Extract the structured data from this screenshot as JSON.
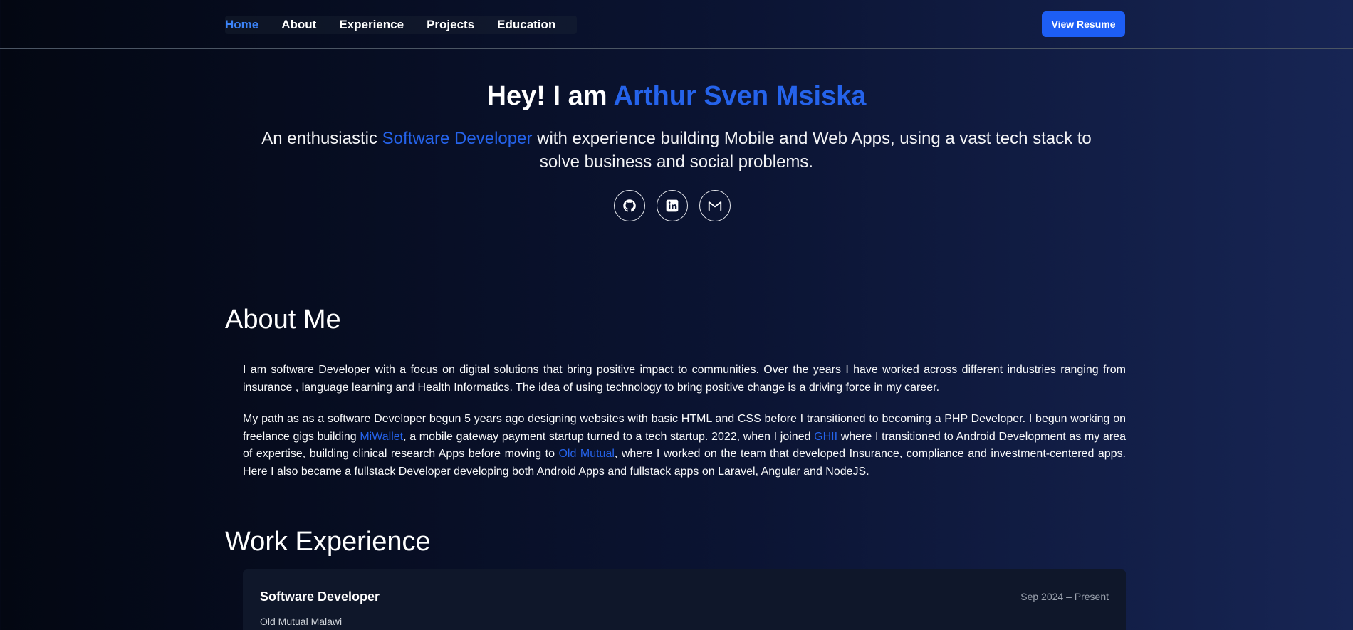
{
  "nav": {
    "items": [
      {
        "label": "Home",
        "active": true
      },
      {
        "label": "About"
      },
      {
        "label": "Experience"
      },
      {
        "label": "Projects"
      },
      {
        "label": "Education"
      }
    ],
    "resume_label": "View Resume"
  },
  "hero": {
    "greeting": "Hey! I am ",
    "name": "Arthur Sven Msiska",
    "subtitle_prefix": "An enthusiastic ",
    "subtitle_role": "Software Developer",
    "subtitle_suffix": " with experience building Mobile and Web Apps, using a vast tech stack to solve business and social problems.",
    "socials": [
      {
        "icon": "github-icon"
      },
      {
        "icon": "linkedin-icon"
      },
      {
        "icon": "gmail-icon"
      }
    ]
  },
  "about": {
    "title": "About Me",
    "p1": "I am software Developer with a focus on digital solutions that bring positive impact to communities. Over the years I have worked across different industries ranging from insurance , language learning and Health Informatics. The idea of using technology to bring positive change is a driving force in my career.",
    "p2_a": "My path as as a software Developer begun 5 years ago designing websites with basic HTML and CSS before I transitioned to becoming a PHP Developer. I begun working on freelance gigs building ",
    "p2_link1": "MiWallet",
    "p2_b": ", a mobile gateway payment startup turned to a tech startup. 2022, when I joined ",
    "p2_link2": "GHII",
    "p2_c": " where I transitioned to Android Development as my area of expertise, building clinical research Apps before moving to ",
    "p2_link3": "Old Mutual",
    "p2_d": ", where I worked on the team that developed Insurance, compliance and investment-centered apps. Here I also became a fullstack Developer developing both Android Apps and fullstack apps on Laravel, Angular and NodeJS."
  },
  "experience": {
    "title": "Work Experience",
    "jobs": [
      {
        "role": "Software Developer",
        "company": "Old Mutual Malawi",
        "dates": "Sep 2024 – Present"
      }
    ]
  },
  "colors": {
    "accent": "#2563eb",
    "button": "#1d5ef5",
    "active_nav": "#3b82f6",
    "bg_left": "#030712",
    "bg_right": "#172554"
  }
}
